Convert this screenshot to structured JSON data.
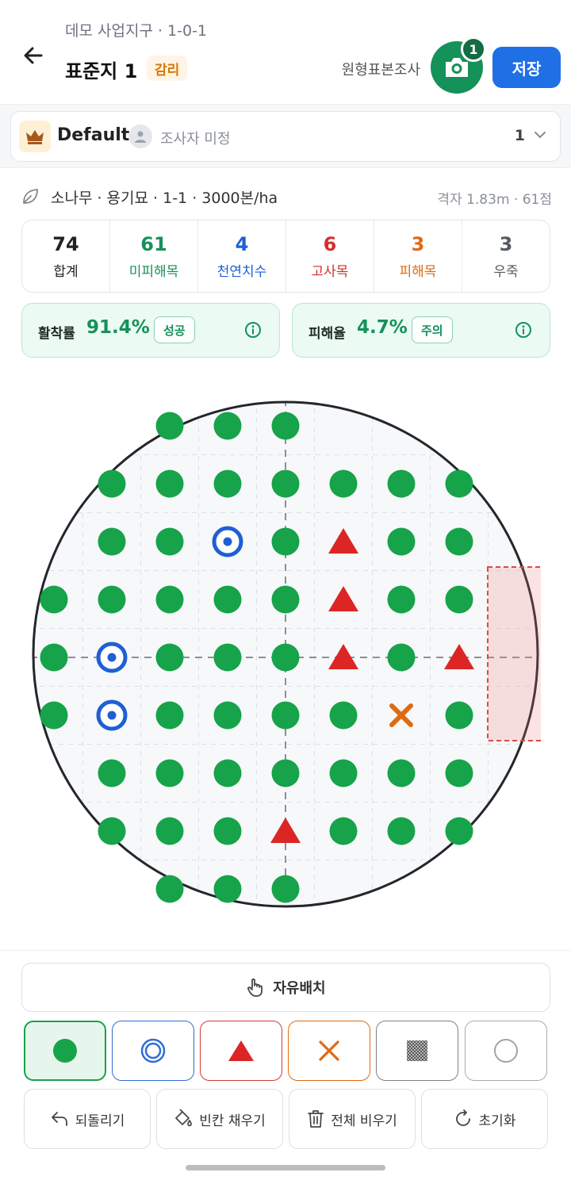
{
  "header": {
    "breadcrumb": "데모 사업지구 · 1-0-1",
    "title": "표준지 1",
    "badge": "감리",
    "survey_type": "원형표본조사",
    "photo_count": "1",
    "save_label": "저장"
  },
  "team": {
    "name": "Default",
    "surveyor": "조사자 미정",
    "number": "1"
  },
  "species": {
    "text": "소나무 · 용기묘 · 1-1 · 3000본/ha",
    "grid": "격자 1.83m · 61점"
  },
  "stats": [
    {
      "value": "74",
      "label": "합계",
      "color": "#222222"
    },
    {
      "value": "61",
      "label": "미피해목",
      "color": "#15915a"
    },
    {
      "value": "4",
      "label": "천연치수",
      "color": "#1f5fd6"
    },
    {
      "value": "6",
      "label": "고사목",
      "color": "#d32f2f"
    },
    {
      "value": "3",
      "label": "피해목",
      "color": "#e06a12"
    },
    {
      "value": "3",
      "label": "우죽",
      "color": "#555b63"
    }
  ],
  "rates": {
    "survival": {
      "label": "활착률",
      "value": "91.4%",
      "badge": "성공"
    },
    "damage": {
      "label": "피해율",
      "value": "4.7%",
      "badge": "주의"
    }
  },
  "plot": {
    "rows": [
      [
        "",
        "",
        "",
        "G",
        "G",
        "G",
        "",
        "",
        ""
      ],
      [
        "",
        "",
        "G",
        "G",
        "G",
        "G",
        "G",
        "G",
        "G"
      ],
      [
        "",
        "",
        "G",
        "G",
        "B",
        "G",
        "R",
        "G",
        "G"
      ],
      [
        "",
        "G",
        "G",
        "G",
        "G",
        "G",
        "R",
        "G",
        "G"
      ],
      [
        "",
        "G",
        "B",
        "G",
        "G",
        "G",
        "R",
        "G",
        "R"
      ],
      [
        "",
        "G",
        "B",
        "G",
        "G",
        "G",
        "G",
        "X",
        "G"
      ],
      [
        "",
        "",
        "G",
        "G",
        "G",
        "G",
        "G",
        "G",
        "G"
      ],
      [
        "",
        "",
        "G",
        "G",
        "G",
        "R",
        "G",
        "G",
        "G"
      ],
      [
        "",
        "",
        "",
        "G",
        "G",
        "G",
        "",
        "",
        ""
      ]
    ],
    "colors": {
      "green": "#16a34a",
      "blue": "#1f5fd6",
      "red": "#dc2626",
      "orange": "#e06a12"
    }
  },
  "bottom": {
    "free_place": "자유배치",
    "tools": [
      "alive-dot",
      "natural-seedling-ring",
      "dead-triangle",
      "damaged-x",
      "sprout-pattern",
      "empty-circle"
    ],
    "actions": [
      "되돌리기",
      "빈칸 채우기",
      "전체 비우기",
      "초기화"
    ]
  }
}
